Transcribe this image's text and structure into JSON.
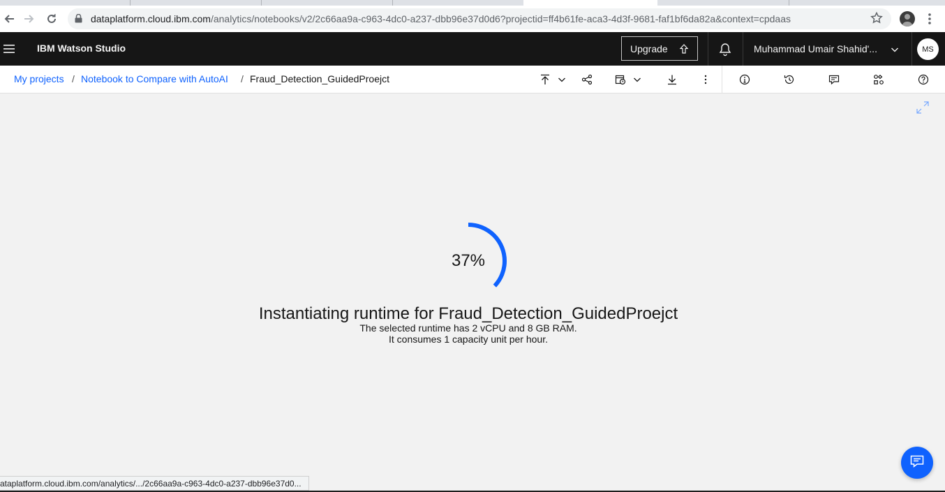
{
  "browser": {
    "url_host": "dataplatform.cloud.ibm.com",
    "url_path": "/analytics/notebooks/v2/2c66aa9a-c963-4dc0-a237-dbb96e37d0d6?projectid=ff4b61fe-aca3-4d3f-9681-faf1bf6da82a&context=cpdaas",
    "status_url": "ataplatform.cloud.ibm.com/analytics/.../2c66aa9a-c963-4dc0-a237-dbb96e37d0..."
  },
  "header": {
    "brand": "IBM Watson Studio",
    "upgrade_label": "Upgrade",
    "account_name": "Muhammad Umair Shahid'...",
    "avatar_initials": "MS"
  },
  "breadcrumb": {
    "items": [
      "My projects",
      "Notebook to Compare with AutoAI",
      "Fraud_Detection_GuidedProejct"
    ],
    "separator": "/"
  },
  "toolbar": {
    "icons": [
      "publish-icon",
      "chevron-down-icon",
      "share-icon",
      "schedule-icon",
      "chevron-down-icon",
      "download-icon",
      "overflow-menu-icon",
      "info-icon",
      "version-history-icon",
      "comments-icon",
      "data-assets-icon",
      "help-icon"
    ]
  },
  "main": {
    "progress_percent": 37,
    "progress_label": "37%",
    "title": "Instantiating runtime for Fraud_Detection_GuidedProejct",
    "line1": "The selected runtime has 2 vCPU and 8 GB RAM.",
    "line2": "It consumes 1 capacity unit per hour."
  },
  "colors": {
    "accent": "#0f62fe",
    "header_bg": "#161616",
    "page_bg": "#f2f2f2"
  }
}
